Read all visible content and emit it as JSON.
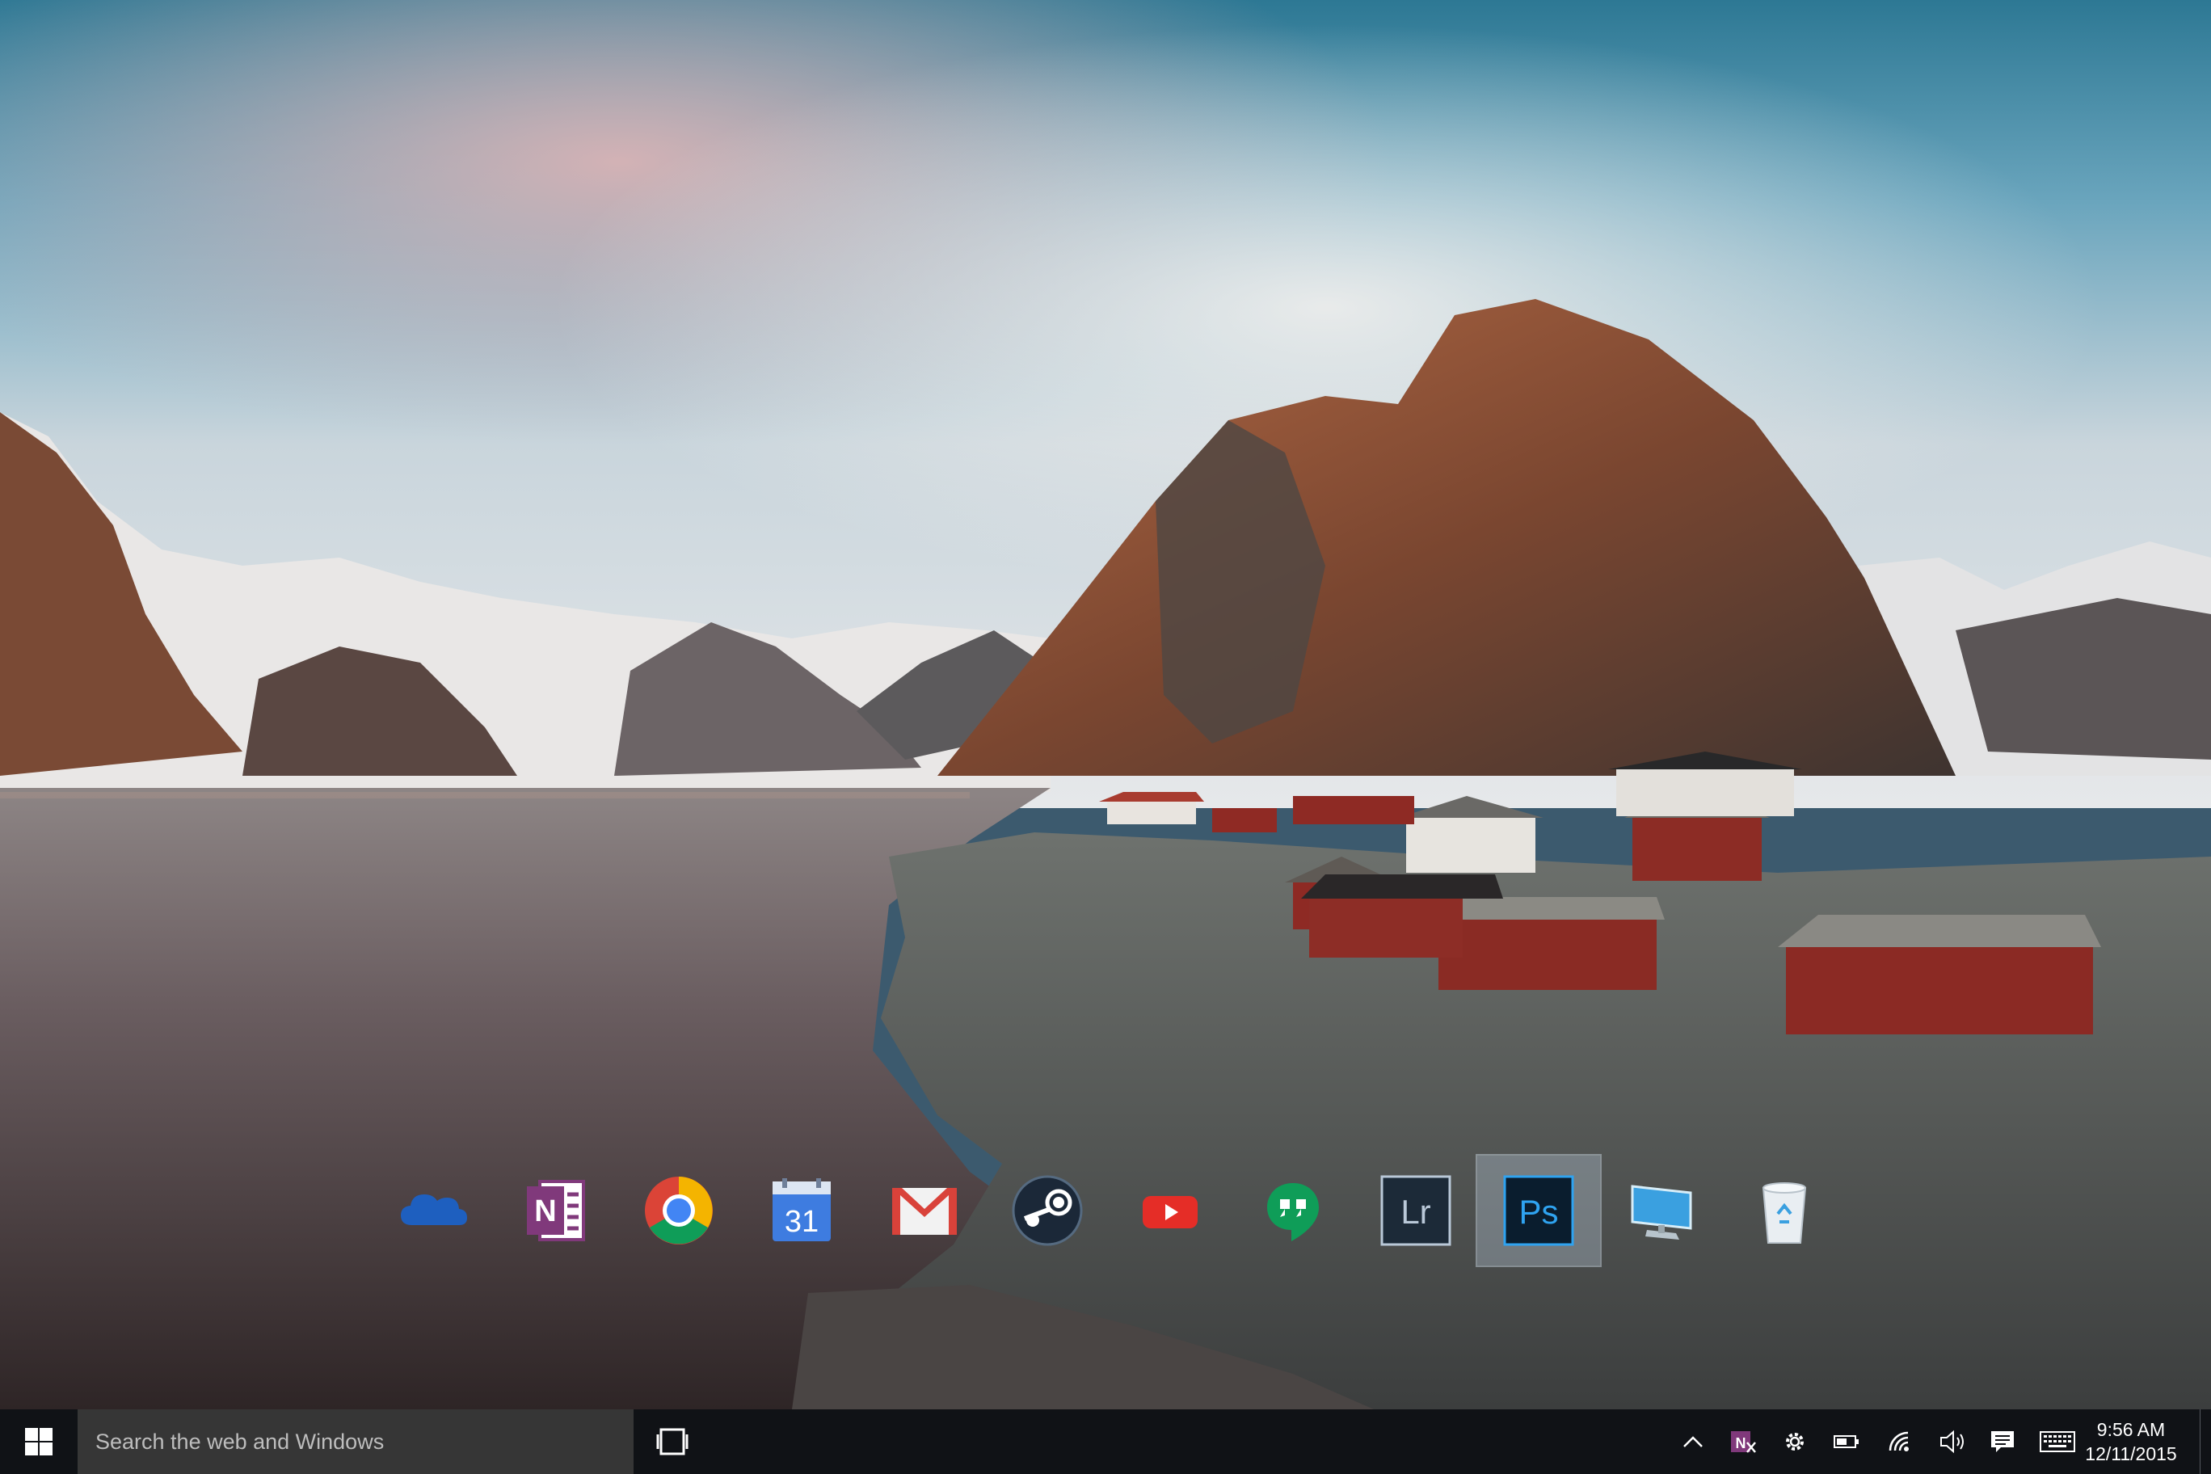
{
  "desktop": {
    "wallpaper": "photo-hamnoy-lofoten-red-cabins-fjord",
    "dock_items": [
      {
        "id": "onedrive",
        "icon": "cloud-icon",
        "color": "#1e5fbf"
      },
      {
        "id": "onenote",
        "icon": "onenote-icon",
        "color": "#80397b",
        "letter": "N"
      },
      {
        "id": "chrome",
        "icon": "chrome-icon"
      },
      {
        "id": "calendar",
        "icon": "calendar-icon",
        "color": "#3e7ce0",
        "text": "31"
      },
      {
        "id": "gmail",
        "icon": "gmail-icon",
        "color": "#d9423a"
      },
      {
        "id": "steam",
        "icon": "steam-icon",
        "color": "#1b2838"
      },
      {
        "id": "youtube",
        "icon": "youtube-icon",
        "color": "#e52d27"
      },
      {
        "id": "hangouts",
        "icon": "hangouts-icon",
        "color": "#0f9d58"
      },
      {
        "id": "lightroom",
        "icon": "lightroom-icon",
        "color": "#1c2a38",
        "text": "Lr"
      },
      {
        "id": "photoshop",
        "icon": "photoshop-icon",
        "color": "#0a1d2e",
        "text": "Ps",
        "selected": true
      },
      {
        "id": "this-pc",
        "icon": "monitor-icon",
        "color": "#3aa0e0"
      },
      {
        "id": "recycle-bin",
        "icon": "recycle-bin-icon"
      }
    ]
  },
  "taskbar": {
    "search_placeholder": "Search the web and Windows",
    "tray_icons": [
      "chevron-up-icon",
      "onenote-clip-icon",
      "gear-icon",
      "battery-icon",
      "wifi-icon",
      "volume-icon",
      "action-center-icon",
      "keyboard-icon"
    ],
    "clock": {
      "time": "9:56 AM",
      "date": "12/11/2015"
    }
  },
  "colors": {
    "taskbar": "#101216",
    "search_box": "#363636",
    "accent_onenote": "#80397b"
  }
}
